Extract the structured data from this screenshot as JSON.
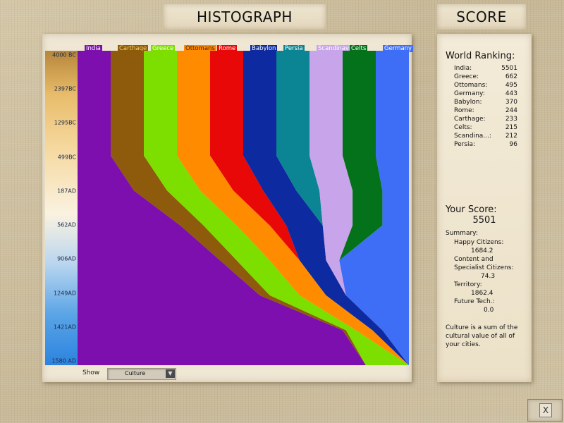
{
  "header": {
    "histograph_title": "HISTOGRAPH",
    "score_title": "SCORE"
  },
  "timeline_ticks": [
    "4000 BC",
    "2397BC",
    "1295BC",
    "499BC",
    "187AD",
    "562AD",
    "906AD",
    "1249AD",
    "1421AD",
    "1580 AD"
  ],
  "civs": [
    {
      "name": "India",
      "color": "#7d0fae",
      "label_bg": "#7d0fae",
      "label_color": "#ffffff"
    },
    {
      "name": "Carthage",
      "color": "#8e5a0b",
      "label_bg": "#8e5a0b",
      "label_color": "#f5d26a"
    },
    {
      "name": "Greece",
      "color": "#7cdf00",
      "label_bg": "#7cdf00",
      "label_color": "#ffffff"
    },
    {
      "name": "Ottomans",
      "color": "#ff8b00",
      "label_bg": "#ff8b00",
      "label_color": "#4a1f00"
    },
    {
      "name": "Rome",
      "color": "#e80808",
      "label_bg": "#e80808",
      "label_color": "#ffffff"
    },
    {
      "name": "Babylon",
      "color": "#0e2aa0",
      "label_bg": "#0e2aa0",
      "label_color": "#ffffff"
    },
    {
      "name": "Persia",
      "color": "#0b8493",
      "label_bg": "#0b8493",
      "label_color": "#ffffff"
    },
    {
      "name": "Scandinavia",
      "color": "#c8a5ea",
      "label_bg": "#c8a5ea",
      "label_color": "#ffffff"
    },
    {
      "name": "Celts",
      "color": "#03721a",
      "label_bg": "#03721a",
      "label_color": "#ffffff"
    },
    {
      "name": "Germany",
      "color": "#3d6ef5",
      "label_bg": "#3d6ef5",
      "label_color": "#ffffff"
    }
  ],
  "score": {
    "world_ranking_title": "World Ranking:",
    "ranking": [
      {
        "name": "India:",
        "value": "5501"
      },
      {
        "name": "Greece:",
        "value": "662"
      },
      {
        "name": "Ottomans:",
        "value": "495"
      },
      {
        "name": "Germany:",
        "value": "443"
      },
      {
        "name": "Babylon:",
        "value": "370"
      },
      {
        "name": "Rome:",
        "value": "244"
      },
      {
        "name": "Carthage:",
        "value": "233"
      },
      {
        "name": "Celts:",
        "value": "215"
      },
      {
        "name": "Scandina...:",
        "value": "212"
      },
      {
        "name": "Persia:",
        "value": "96"
      }
    ],
    "your_score_title": "Your Score:",
    "your_score_value": "5501",
    "summary_title": "Summary:",
    "happy_label": "Happy Citizens:",
    "happy_value": "1684.2",
    "content_label_1": "Content and",
    "content_label_2": "Specialist Citizens:",
    "content_value": "74.3",
    "territory_label": "Territory:",
    "territory_value": "1862.4",
    "future_label": "Future Tech.:",
    "future_value": "0.0",
    "culture_note": "Culture is a sum of the cultural value of all of your cities."
  },
  "controls": {
    "show_label": "Show",
    "show_value": "Culture",
    "close_symbol": "X"
  },
  "chart_data": {
    "type": "area",
    "stacked": true,
    "normalized": true,
    "x": [
      "4000 BC",
      "2397BC",
      "1295BC",
      "499BC",
      "187AD",
      "562AD",
      "906AD",
      "1249AD",
      "1421AD",
      "1580 AD"
    ],
    "series": [
      {
        "name": "India",
        "values": [
          10,
          10,
          10,
          10,
          17,
          31,
          43,
          55,
          80,
          87
        ]
      },
      {
        "name": "Carthage",
        "values": [
          10,
          10,
          10,
          10,
          10,
          7,
          5,
          3,
          1,
          0
        ]
      },
      {
        "name": "Greece",
        "values": [
          10,
          10,
          10,
          10,
          10,
          10,
          10,
          9,
          3,
          13
        ]
      },
      {
        "name": "Ottomans",
        "values": [
          10,
          10,
          10,
          10,
          10,
          10,
          9,
          8,
          5,
          0
        ]
      },
      {
        "name": "Rome",
        "values": [
          10,
          10,
          10,
          10,
          9,
          5,
          0,
          0,
          0,
          0
        ]
      },
      {
        "name": "Babylon",
        "values": [
          10,
          10,
          10,
          10,
          10,
          11,
          8,
          6,
          3,
          0
        ]
      },
      {
        "name": "Persia",
        "values": [
          10,
          10,
          10,
          10,
          7,
          0,
          0,
          0,
          0,
          0
        ]
      },
      {
        "name": "Scandinavia",
        "values": [
          10,
          10,
          10,
          10,
          10,
          9,
          4,
          0,
          0,
          0
        ]
      },
      {
        "name": "Celts",
        "values": [
          10,
          10,
          10,
          10,
          9,
          9,
          0,
          0,
          0,
          0
        ]
      },
      {
        "name": "Germany",
        "values": [
          10,
          10,
          10,
          10,
          8,
          8,
          21,
          19,
          8,
          0
        ]
      }
    ]
  }
}
